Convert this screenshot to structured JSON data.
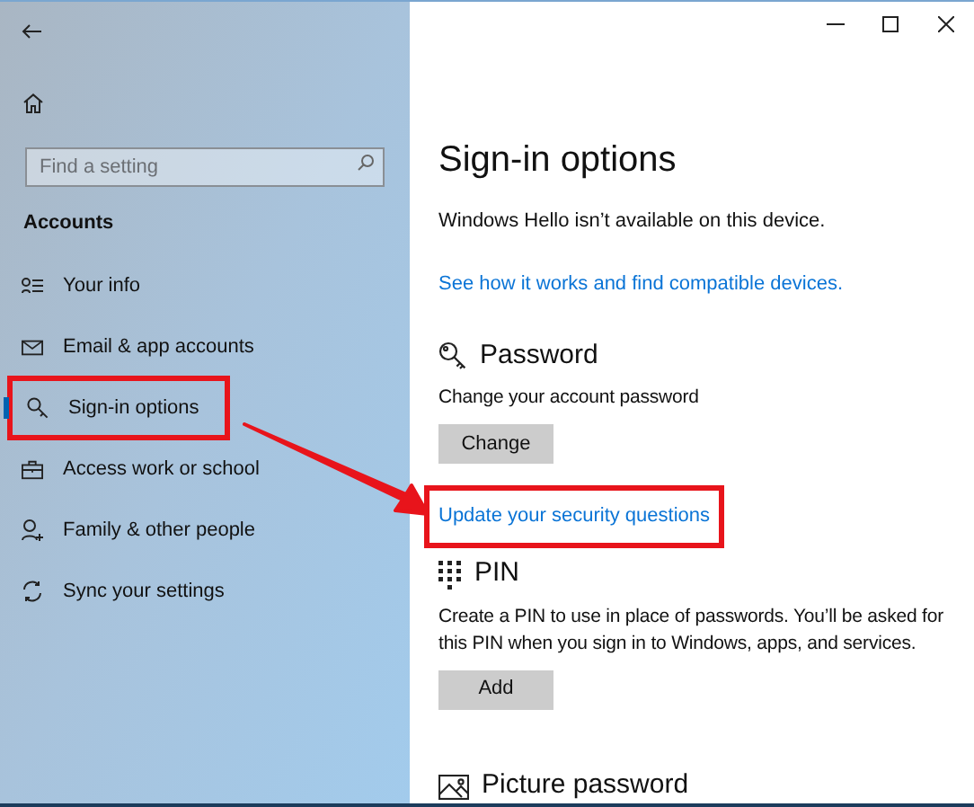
{
  "sidebar": {
    "search": {
      "placeholder": "Find a setting"
    },
    "section": "Accounts",
    "items": [
      {
        "label": "Your info",
        "selected": false,
        "highlighted": false
      },
      {
        "label": "Email & app accounts",
        "selected": false,
        "highlighted": false
      },
      {
        "label": "Sign-in options",
        "selected": true,
        "highlighted": true
      },
      {
        "label": "Access work or school",
        "selected": false,
        "highlighted": false
      },
      {
        "label": "Family & other people",
        "selected": false,
        "highlighted": false
      },
      {
        "label": "Sync your settings",
        "selected": false,
        "highlighted": false
      }
    ]
  },
  "page": {
    "title": "Sign-in options",
    "hello_text": "Windows Hello isn’t available on this device.",
    "hello_link": "See how it works and find compatible devices.",
    "sections": [
      {
        "heading": "Password",
        "description": "Change your account password",
        "button": "Change",
        "link": "Update your security questions",
        "link_highlighted": true
      },
      {
        "heading": "PIN",
        "description": "Create a PIN to use in place of passwords. You’ll be asked for this PIN when you sign in to Windows, apps, and services.",
        "button": "Add"
      },
      {
        "heading": "Picture password"
      }
    ]
  }
}
